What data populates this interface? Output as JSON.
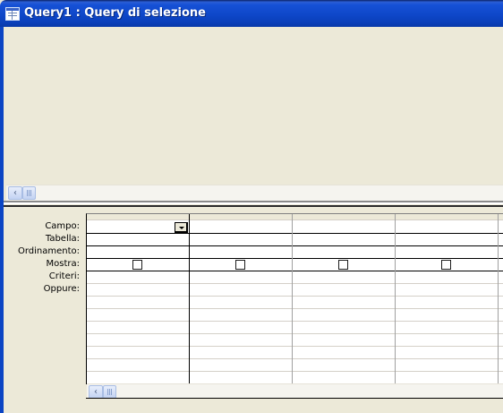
{
  "window": {
    "title": "Query1 : Query di selezione",
    "icon": "query-icon"
  },
  "design_grid": {
    "row_labels": [
      "Campo:",
      "Tabella:",
      "Ordinamento:",
      "Mostra:",
      "Criteri:",
      "Oppure:"
    ],
    "columns": [
      {
        "campo": "",
        "tabella": "",
        "ordinamento": "",
        "mostra": false,
        "criteri": "",
        "oppure": ""
      },
      {
        "campo": "",
        "tabella": "",
        "ordinamento": "",
        "mostra": false,
        "criteri": "",
        "oppure": ""
      },
      {
        "campo": "",
        "tabella": "",
        "ordinamento": "",
        "mostra": false,
        "criteri": "",
        "oppure": ""
      },
      {
        "campo": "",
        "tabella": "",
        "ordinamento": "",
        "mostra": false,
        "criteri": "",
        "oppure": ""
      }
    ]
  },
  "icons": {
    "scroll_left": "chevron-left-icon",
    "dropdown": "dropdown-arrow-icon"
  },
  "colors": {
    "titlebar": "#0e47c9",
    "workspace": "#ece9d8",
    "grid_background": "#ffffff"
  }
}
